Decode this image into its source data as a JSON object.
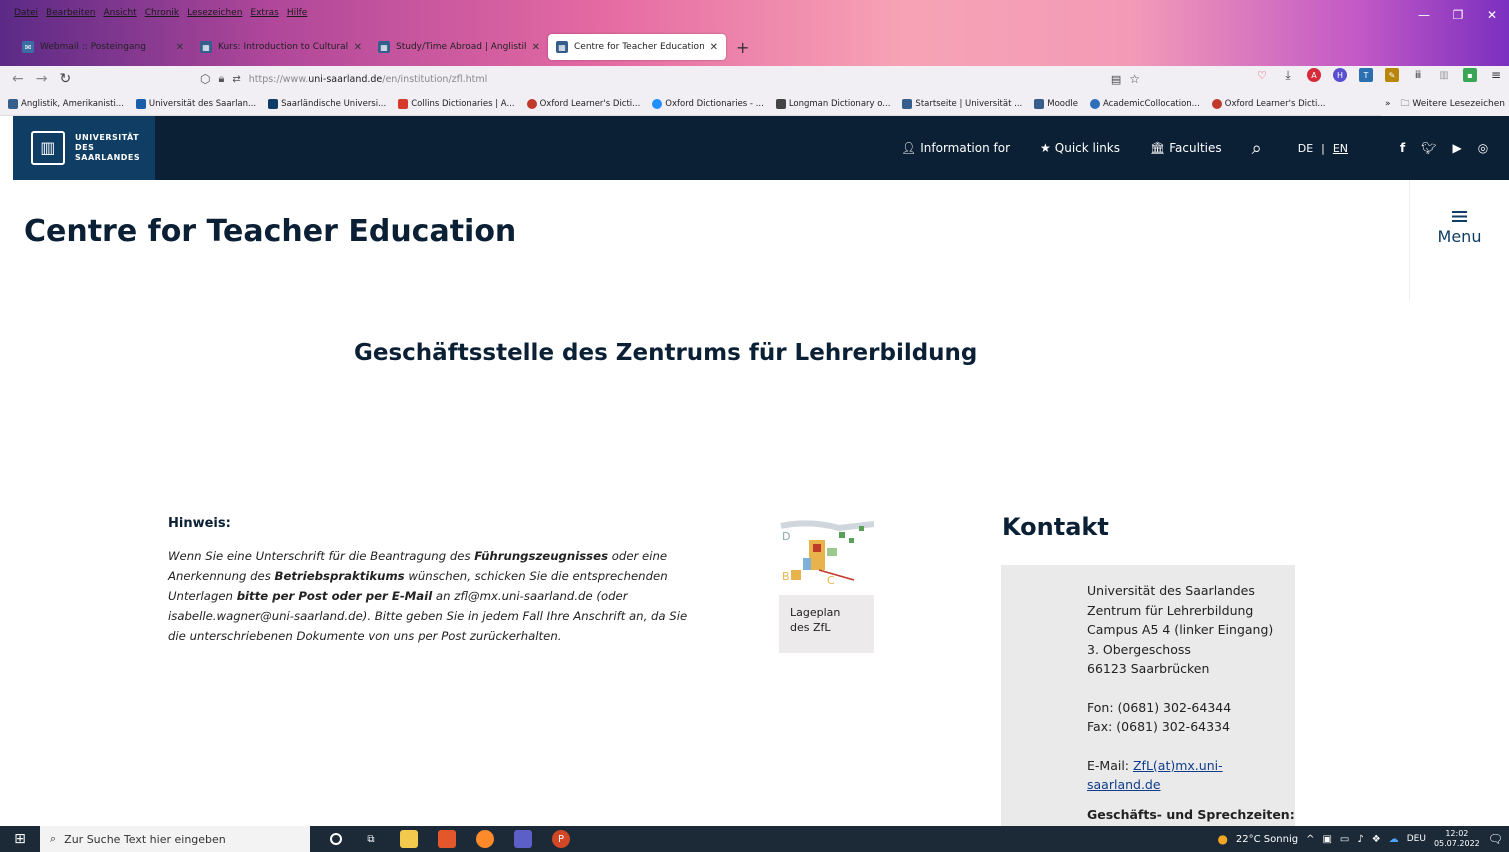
{
  "browser": {
    "menu": [
      "Datei",
      "Bearbeiten",
      "Ansicht",
      "Chronik",
      "Lesezeichen",
      "Extras",
      "Hilfe"
    ],
    "tabs": [
      {
        "label": "Webmail :: Posteingang",
        "active": false
      },
      {
        "label": "Kurs: Introduction to Cultural St",
        "active": false
      },
      {
        "label": "Study/Time Abroad | Anglistik,",
        "active": false
      },
      {
        "label": "Centre for Teacher Education | U",
        "active": true
      }
    ],
    "url_prefix": "https://www.",
    "url_domain": "uni-saarland.de",
    "url_path": "/en/institution/zfl.html",
    "bookmarks": [
      "Anglistik, Amerikanisti...",
      "Universität des Saarlan...",
      "Saarländische Universi...",
      "Collins Dictionaries | A...",
      "Oxford Learner's Dicti...",
      "Oxford Dictionaries - ...",
      "Longman Dictionary o...",
      "Startseite | Universität ...",
      "Moodle",
      "AcademicCollocation...",
      "Oxford Learner's Dicti..."
    ],
    "bookmarks_more": "Weitere Lesezeichen"
  },
  "site": {
    "logo_line1": "UNIVERSITÄT",
    "logo_line2": "DES",
    "logo_line3": "SAARLANDES",
    "nav": {
      "info": "Information for",
      "quick": "Quick links",
      "faculties": "Faculties",
      "lang_de": "DE",
      "lang_sep": "|",
      "lang_en": "EN"
    },
    "page_title": "Centre for Teacher Education",
    "menu_label": "Menu",
    "heading": "Geschäftsstelle des Zentrums für Lehrerbildung",
    "hint_title": "Hinweis:",
    "hint": {
      "p1": "Wenn Sie eine Unterschrift für die Beantragung des ",
      "b1": "Führungszeugnisses",
      "p2": " oder eine Anerkennung des ",
      "b2": "Betriebspraktikums",
      "p3": " wünschen, schicken Sie die entsprechenden Unterlagen ",
      "b3": "bitte per Post oder per E-Mail",
      "p4": " an zfl@mx.uni-saarland.de (oder isabelle.wagner@uni-saarland.de). Bitte geben Sie in jedem Fall Ihre Anschrift an, da Sie die unterschriebenen Dokumente von uns per Post zurückerhalten."
    },
    "map_caption": "Lageplan des ZfL",
    "contact_title": "Kontakt",
    "contact": {
      "l1": "Universität des Saarlandes",
      "l2": "Zentrum für Lehrerbildung",
      "l3": "Campus A5 4 (linker Eingang)",
      "l4": "3. Obergeschoss",
      "l5": "66123 Saarbrücken",
      "fon": "Fon: (0681) 302-64344",
      "fax": "Fax: (0681) 302-64334",
      "email_label": "E-Mail: ",
      "email": "ZfL(at)mx.uni-saarland.de",
      "hours": "Geschäfts- und Sprechzeiten:"
    }
  },
  "taskbar": {
    "search_placeholder": "Zur Suche Text hier eingeben",
    "weather": "22°C  Sonnig",
    "lang": "DEU",
    "time": "12:02",
    "date": "05.07.2022"
  }
}
